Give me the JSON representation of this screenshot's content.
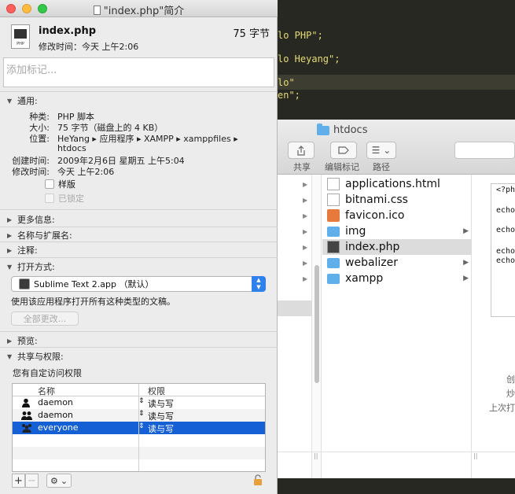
{
  "window_title": "\"index.php\"简介",
  "file": {
    "name": "index.php",
    "size": "75 字节",
    "modified_line": "修改时间：今天 上午2:06",
    "icon_label": "PHP"
  },
  "tags_placeholder": "添加标记...",
  "sections": {
    "general": "通用:",
    "more_info": "更多信息:",
    "name_ext": "名称与扩展名:",
    "comments": "注释:",
    "open_with": "打开方式:",
    "preview": "预览:",
    "sharing": "共享与权限:"
  },
  "general": {
    "kind_label": "种类:",
    "kind": "PHP 脚本",
    "size_label": "大小:",
    "size": "75 字节（磁盘上的 4 KB）",
    "where_label": "位置:",
    "where_line1": "HeYang ▸ 应用程序 ▸ XAMPP ▸ xamppfiles ▸",
    "where_line2": "htdocs",
    "created_label": "创建时间:",
    "created": "2009年2月6日 星期五 上午5:04",
    "modified_label": "修改时间:",
    "modified": "今天 上午2:06",
    "stationery": "样版",
    "locked": "已锁定"
  },
  "open_with": {
    "app": "Sublime Text 2.app （默认）",
    "desc": "使用该应用程序打开所有这种类型的文稿。",
    "change_all": "全部更改..."
  },
  "sharing": {
    "desc": "您有自定访问权限",
    "col_name": "名称",
    "col_priv": "权限",
    "rows": [
      {
        "name": "daemon",
        "priv": "读与写",
        "icon": "user-icon"
      },
      {
        "name": "daemon",
        "priv": "读与写",
        "icon": "group-icon"
      },
      {
        "name": "everyone",
        "priv": "读与写",
        "icon": "everyone-icon"
      }
    ]
  },
  "editor": {
    "line1": "lo PHP\";",
    "line2": "lo Heyang\";",
    "line3": "lo\"",
    "line4": "en\";"
  },
  "finder": {
    "title": "htdocs",
    "toolbar": {
      "share": "共享",
      "tags": "编辑标记",
      "path": "路径"
    },
    "files": [
      {
        "name": "applications.html",
        "type": "doc"
      },
      {
        "name": "bitnami.css",
        "type": "doc"
      },
      {
        "name": "favicon.ico",
        "type": "ico"
      },
      {
        "name": "img",
        "type": "folder"
      },
      {
        "name": "index.php",
        "type": "php"
      },
      {
        "name": "webalizer",
        "type": "folder"
      },
      {
        "name": "xampp",
        "type": "folder"
      }
    ],
    "preview_lines": [
      "<?ph",
      "echo",
      "echo",
      "echo",
      "echo"
    ],
    "meta": [
      "创",
      "炒",
      "上次打"
    ]
  }
}
